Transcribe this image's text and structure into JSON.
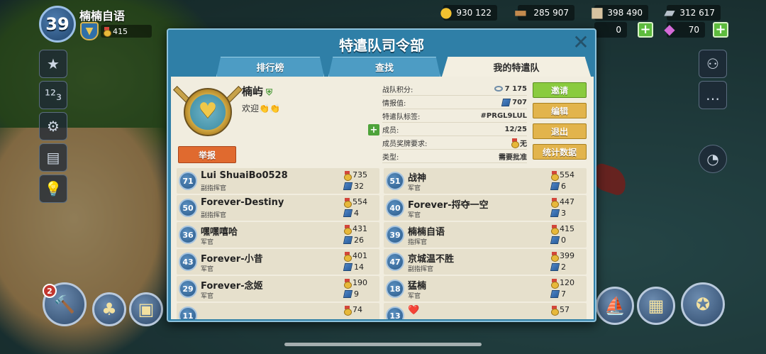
{
  "hud": {
    "player_level": "39",
    "player_name": "楠楠自语",
    "player_medals": "415",
    "resources": {
      "gold": "930 122",
      "wood": "285 907",
      "stone": "398 490",
      "iron": "312 617",
      "diamonds": "70",
      "extra": "0"
    },
    "builder_count": "2"
  },
  "modal": {
    "title": "特遣队司令部",
    "close_icon": "close-icon",
    "tabs": [
      {
        "label": "排行榜",
        "active": false
      },
      {
        "label": "查找",
        "active": false
      },
      {
        "label": "我的特遣队",
        "active": true
      }
    ]
  },
  "taskforce": {
    "name": "楠屿",
    "description": "欢迎👏👏",
    "report_label": "举报",
    "stats": [
      {
        "label": "战队积分:",
        "value": "7 175",
        "icon": "score-icon"
      },
      {
        "label": "情报值:",
        "value": "707",
        "icon": "intel-icon"
      },
      {
        "label": "特遣队标签:",
        "value": "#PRGL9LUL",
        "icon": ""
      },
      {
        "label": "成员:",
        "value": "12/25",
        "icon": ""
      },
      {
        "label": "成员奖牌要求:",
        "value": "无",
        "icon": "medal-icon"
      },
      {
        "label": "类型:",
        "value": "需要批准",
        "icon": ""
      }
    ],
    "actions": {
      "invite": "邀请",
      "edit": "编辑",
      "leave": "退出",
      "statistics": "统计数据"
    }
  },
  "members": [
    {
      "rank": "71",
      "name": "Lui ShuaiBo0528",
      "role": "副指挥官",
      "medals": "735",
      "intel": "32"
    },
    {
      "rank": "51",
      "name": "战神",
      "role": "军官",
      "medals": "554",
      "intel": "6"
    },
    {
      "rank": "50",
      "name": "Forever-Destiny",
      "role": "副指挥官",
      "medals": "554",
      "intel": "4"
    },
    {
      "rank": "40",
      "name": "Forever-捋夺一空",
      "role": "军官",
      "medals": "447",
      "intel": "3"
    },
    {
      "rank": "36",
      "name": "嘿嘿嘻哈",
      "role": "军官",
      "medals": "431",
      "intel": "26"
    },
    {
      "rank": "39",
      "name": "楠楠自语",
      "role": "指挥官",
      "medals": "415",
      "intel": "0"
    },
    {
      "rank": "43",
      "name": "Forever-小昔",
      "role": "军官",
      "medals": "401",
      "intel": "14"
    },
    {
      "rank": "47",
      "name": "京城温不胜",
      "role": "副指挥官",
      "medals": "399",
      "intel": "2"
    },
    {
      "rank": "29",
      "name": "Forever-念姬",
      "role": "军官",
      "medals": "190",
      "intel": "9"
    },
    {
      "rank": "18",
      "name": "猛楠",
      "role": "军官",
      "medals": "120",
      "intel": "7"
    },
    {
      "rank": "11",
      "name": "",
      "role": "",
      "medals": "74",
      "intel": ""
    },
    {
      "rank": "13",
      "name": "❤️",
      "role": "",
      "medals": "57",
      "intel": ""
    }
  ]
}
